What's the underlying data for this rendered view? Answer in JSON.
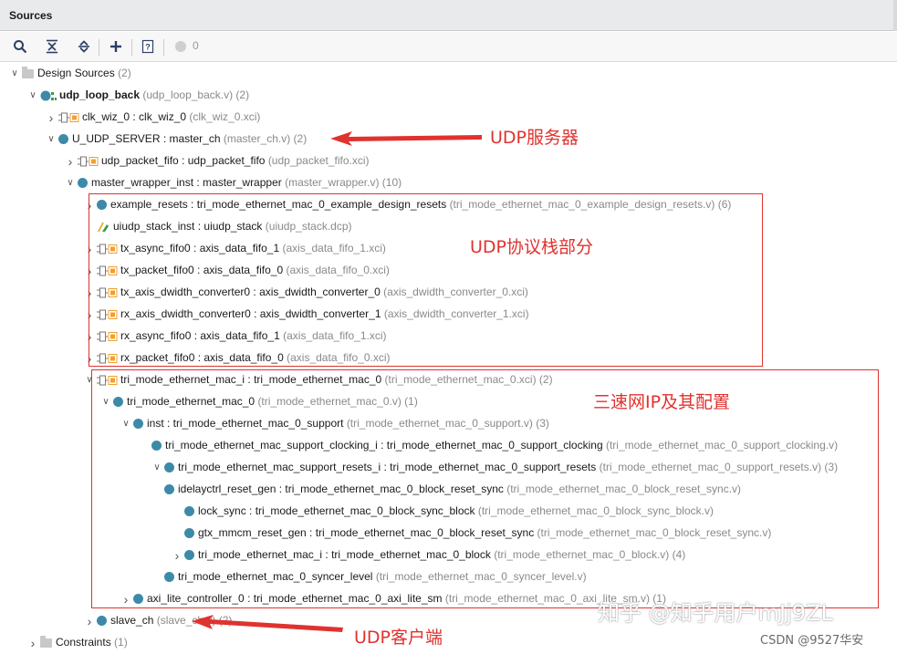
{
  "panel": {
    "title": "Sources"
  },
  "toolbar": {
    "icons": [
      "search-icon",
      "collapse-all-icon",
      "expand-all-icon",
      "add-icon",
      "help-icon",
      "status-circle-icon"
    ],
    "count": "0"
  },
  "tree": [
    {
      "name": "Design Sources",
      "meta": "(2)",
      "icon": "folder-icon",
      "toggle": "expanded"
    },
    {
      "name": "udp_loop_back",
      "meta": "(udp_loop_back.v) (2)",
      "icon": "hierarchy-icon",
      "toggle": "expanded",
      "bold": true
    },
    {
      "name": "clk_wiz_0 : clk_wiz_0",
      "meta": "(clk_wiz_0.xci)",
      "icon": "ip-icon",
      "toggle": "collapsed"
    },
    {
      "name": "U_UDP_SERVER : master_ch",
      "meta": "(master_ch.v) (2)",
      "icon": "module-icon",
      "toggle": "expanded"
    },
    {
      "name": "udp_packet_fifo : udp_packet_fifo",
      "meta": "(udp_packet_fifo.xci)",
      "icon": "ip-icon",
      "toggle": "collapsed"
    },
    {
      "name": "master_wrapper_inst : master_wrapper",
      "meta": "(master_wrapper.v) (10)",
      "icon": "module-icon",
      "toggle": "expanded"
    },
    {
      "name": "example_resets : tri_mode_ethernet_mac_0_example_design_resets",
      "meta": "(tri_mode_ethernet_mac_0_example_design_resets.v) (6)",
      "icon": "module-icon",
      "toggle": "collapsed"
    },
    {
      "name": "uiudp_stack_inst : uiudp_stack",
      "meta": "(uiudp_stack.dcp)",
      "icon": "dcp-icon",
      "toggle": "none"
    },
    {
      "name": "tx_async_fifo0 : axis_data_fifo_1",
      "meta": "(axis_data_fifo_1.xci)",
      "icon": "ip-icon",
      "toggle": "collapsed"
    },
    {
      "name": "tx_packet_fifo0 : axis_data_fifo_0",
      "meta": "(axis_data_fifo_0.xci)",
      "icon": "ip-icon",
      "toggle": "collapsed"
    },
    {
      "name": "tx_axis_dwidth_converter0 : axis_dwidth_converter_0",
      "meta": "(axis_dwidth_converter_0.xci)",
      "icon": "ip-icon",
      "toggle": "collapsed"
    },
    {
      "name": "rx_axis_dwidth_converter0 : axis_dwidth_converter_1",
      "meta": "(axis_dwidth_converter_1.xci)",
      "icon": "ip-icon",
      "toggle": "collapsed"
    },
    {
      "name": "rx_async_fifo0 : axis_data_fifo_1",
      "meta": "(axis_data_fifo_1.xci)",
      "icon": "ip-icon",
      "toggle": "collapsed"
    },
    {
      "name": "rx_packet_fifo0 : axis_data_fifo_0",
      "meta": "(axis_data_fifo_0.xci)",
      "icon": "ip-icon",
      "toggle": "collapsed"
    },
    {
      "name": "tri_mode_ethernet_mac_i : tri_mode_ethernet_mac_0",
      "meta": "(tri_mode_ethernet_mac_0.xci) (2)",
      "icon": "ip-icon",
      "toggle": "expanded"
    },
    {
      "name": "tri_mode_ethernet_mac_0",
      "meta": "(tri_mode_ethernet_mac_0.v) (1)",
      "icon": "module-icon",
      "toggle": "expanded"
    },
    {
      "name": "inst : tri_mode_ethernet_mac_0_support",
      "meta": "(tri_mode_ethernet_mac_0_support.v) (3)",
      "icon": "module-icon",
      "toggle": "expanded"
    },
    {
      "name": "tri_mode_ethernet_mac_support_clocking_i : tri_mode_ethernet_mac_0_support_clocking",
      "meta": "(tri_mode_ethernet_mac_0_support_clocking.v)",
      "icon": "module-icon",
      "toggle": "none"
    },
    {
      "name": "tri_mode_ethernet_mac_support_resets_i : tri_mode_ethernet_mac_0_support_resets",
      "meta": "(tri_mode_ethernet_mac_0_support_resets.v) (3)",
      "icon": "module-icon",
      "toggle": "expanded"
    },
    {
      "name": "idelayctrl_reset_gen : tri_mode_ethernet_mac_0_block_reset_sync",
      "meta": "(tri_mode_ethernet_mac_0_block_reset_sync.v)",
      "icon": "module-icon",
      "toggle": "none"
    },
    {
      "name": "lock_sync : tri_mode_ethernet_mac_0_block_sync_block",
      "meta": "(tri_mode_ethernet_mac_0_block_sync_block.v)",
      "icon": "module-icon",
      "toggle": "none"
    },
    {
      "name": "gtx_mmcm_reset_gen : tri_mode_ethernet_mac_0_block_reset_sync",
      "meta": "(tri_mode_ethernet_mac_0_block_reset_sync.v)",
      "icon": "module-icon",
      "toggle": "none"
    },
    {
      "name": "tri_mode_ethernet_mac_i : tri_mode_ethernet_mac_0_block",
      "meta": "(tri_mode_ethernet_mac_0_block.v) (4)",
      "icon": "module-icon",
      "toggle": "collapsed"
    },
    {
      "name": "tri_mode_ethernet_mac_0_syncer_level",
      "meta": "(tri_mode_ethernet_mac_0_syncer_level.v)",
      "icon": "module-icon",
      "toggle": "none"
    },
    {
      "name": "axi_lite_controller_0 : tri_mode_ethernet_mac_0_axi_lite_sm",
      "meta": "(tri_mode_ethernet_mac_0_axi_lite_sm.v) (1)",
      "icon": "module-icon",
      "toggle": "collapsed"
    },
    {
      "name": "slave_ch",
      "meta": "(slave_ch.v) (2)",
      "icon": "module-icon",
      "toggle": "collapsed"
    },
    {
      "name": "Constraints",
      "meta": "(1)",
      "icon": "folder-icon",
      "toggle": "collapsed"
    }
  ],
  "annotations": {
    "server": "UDP服务器",
    "stack": "UDP协议栈部分",
    "mac": "三速网IP及其配置",
    "client": "UDP客户端"
  },
  "watermarks": {
    "zhihu": "知乎 @知乎用户mJj9ZL",
    "csdn": "CSDN @9527华安"
  },
  "colors": {
    "annotation": "#e0322e",
    "module_dot": "#3d8aa8",
    "ip_orange": "#f0a030",
    "meta_gray": "#8a8a8a"
  }
}
